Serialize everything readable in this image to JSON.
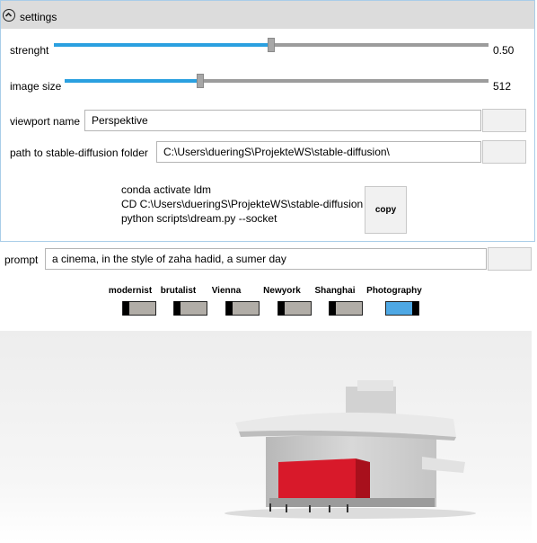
{
  "settings": {
    "header_label": "settings",
    "strength": {
      "label": "strenght",
      "value": 0.5,
      "display": "0.50"
    },
    "image_size": {
      "label": "image size",
      "fraction": 0.32,
      "display": "512"
    },
    "viewport_name": {
      "label": "viewport name",
      "value": "Perspektive"
    },
    "path": {
      "label": "path to stable-diffusion folder",
      "value": "C:\\Users\\dueringS\\ProjekteWS\\stable-diffusion\\"
    },
    "commands": [
      "conda activate ldm",
      "CD C:\\Users\\dueringS\\ProjekteWS\\stable-diffusion",
      "python scripts\\dream.py --socket"
    ],
    "copy_label": "copy"
  },
  "prompt": {
    "label": "prompt",
    "value": "a cinema, in the style of  zaha hadid, a sumer day"
  },
  "styles": [
    {
      "label": "modernist",
      "on": false
    },
    {
      "label": "brutalist",
      "on": false
    },
    {
      "label": "Vienna",
      "on": false
    },
    {
      "label": "Newyork",
      "on": false
    },
    {
      "label": "Shanghai",
      "on": false
    },
    {
      "label": "Photography",
      "on": true
    }
  ],
  "colors": {
    "accent": "#2aa0e0",
    "toggle_on": "#4ea8e4",
    "toggle_off": "#b1ada7",
    "building_red": "#d8192a"
  }
}
